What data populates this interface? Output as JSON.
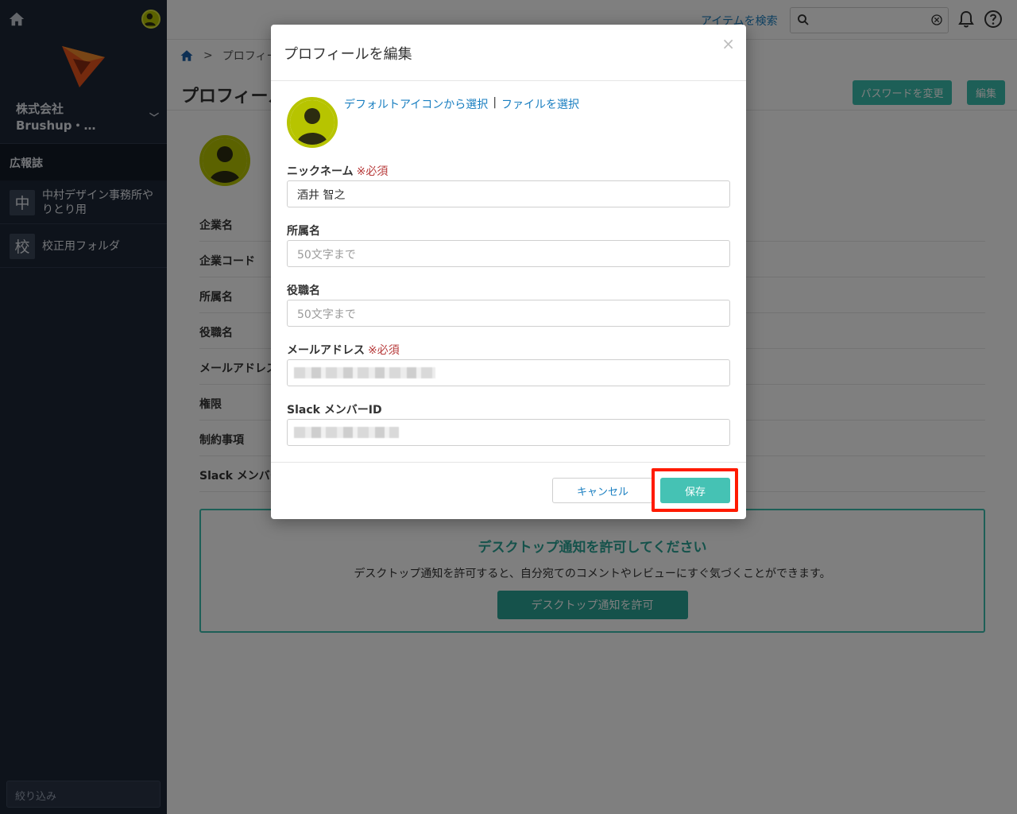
{
  "colors": {
    "accent": "#3bbfae",
    "link": "#1a7fc1",
    "required": "#b73a3a",
    "highlight": "#ff1a00",
    "sidebar_bg": "#1d2636"
  },
  "sidebar": {
    "company": "株式会社Brushup・…",
    "section": "広報誌",
    "items": [
      {
        "badge": "中",
        "label": "中村デザイン事務所やりとり用"
      },
      {
        "badge": "校",
        "label": "校正用フォルダ"
      }
    ],
    "filter_placeholder": "絞り込み"
  },
  "topbar": {
    "search_link": "アイテムを検索"
  },
  "main": {
    "breadcrumb_sep": ">",
    "breadcrumb_current": "プロフィール",
    "title": "プロフィール",
    "password_button": "パスワードを変更",
    "edit_button": "編集",
    "rows": [
      "企業名",
      "企業コード",
      "所属名",
      "役職名",
      "メールアドレス",
      "権限",
      "制約事項",
      "Slack メンバーID"
    ],
    "notify_title": "デスクトップ通知を許可してください",
    "notify_text": "デスクトップ通知を許可すると、自分宛てのコメントやレビューにすぐ気づくことができます。",
    "notify_button": "デスクトップ通知を許可"
  },
  "modal": {
    "title": "プロフィールを編集",
    "close": "×",
    "icon_default_link": "デフォルトアイコンから選択",
    "icon_sep": "|",
    "icon_file_link": "ファイルを選択",
    "required_mark": "※必須",
    "nickname_label": "ニックネーム",
    "nickname_value": "酒井 智之",
    "department_label": "所属名",
    "department_placeholder": "50文字まで",
    "position_label": "役職名",
    "position_placeholder": "50文字まで",
    "email_label": "メールアドレス",
    "slack_label": "Slack メンバーID",
    "cancel_button": "キャンセル",
    "save_button": "保存"
  }
}
